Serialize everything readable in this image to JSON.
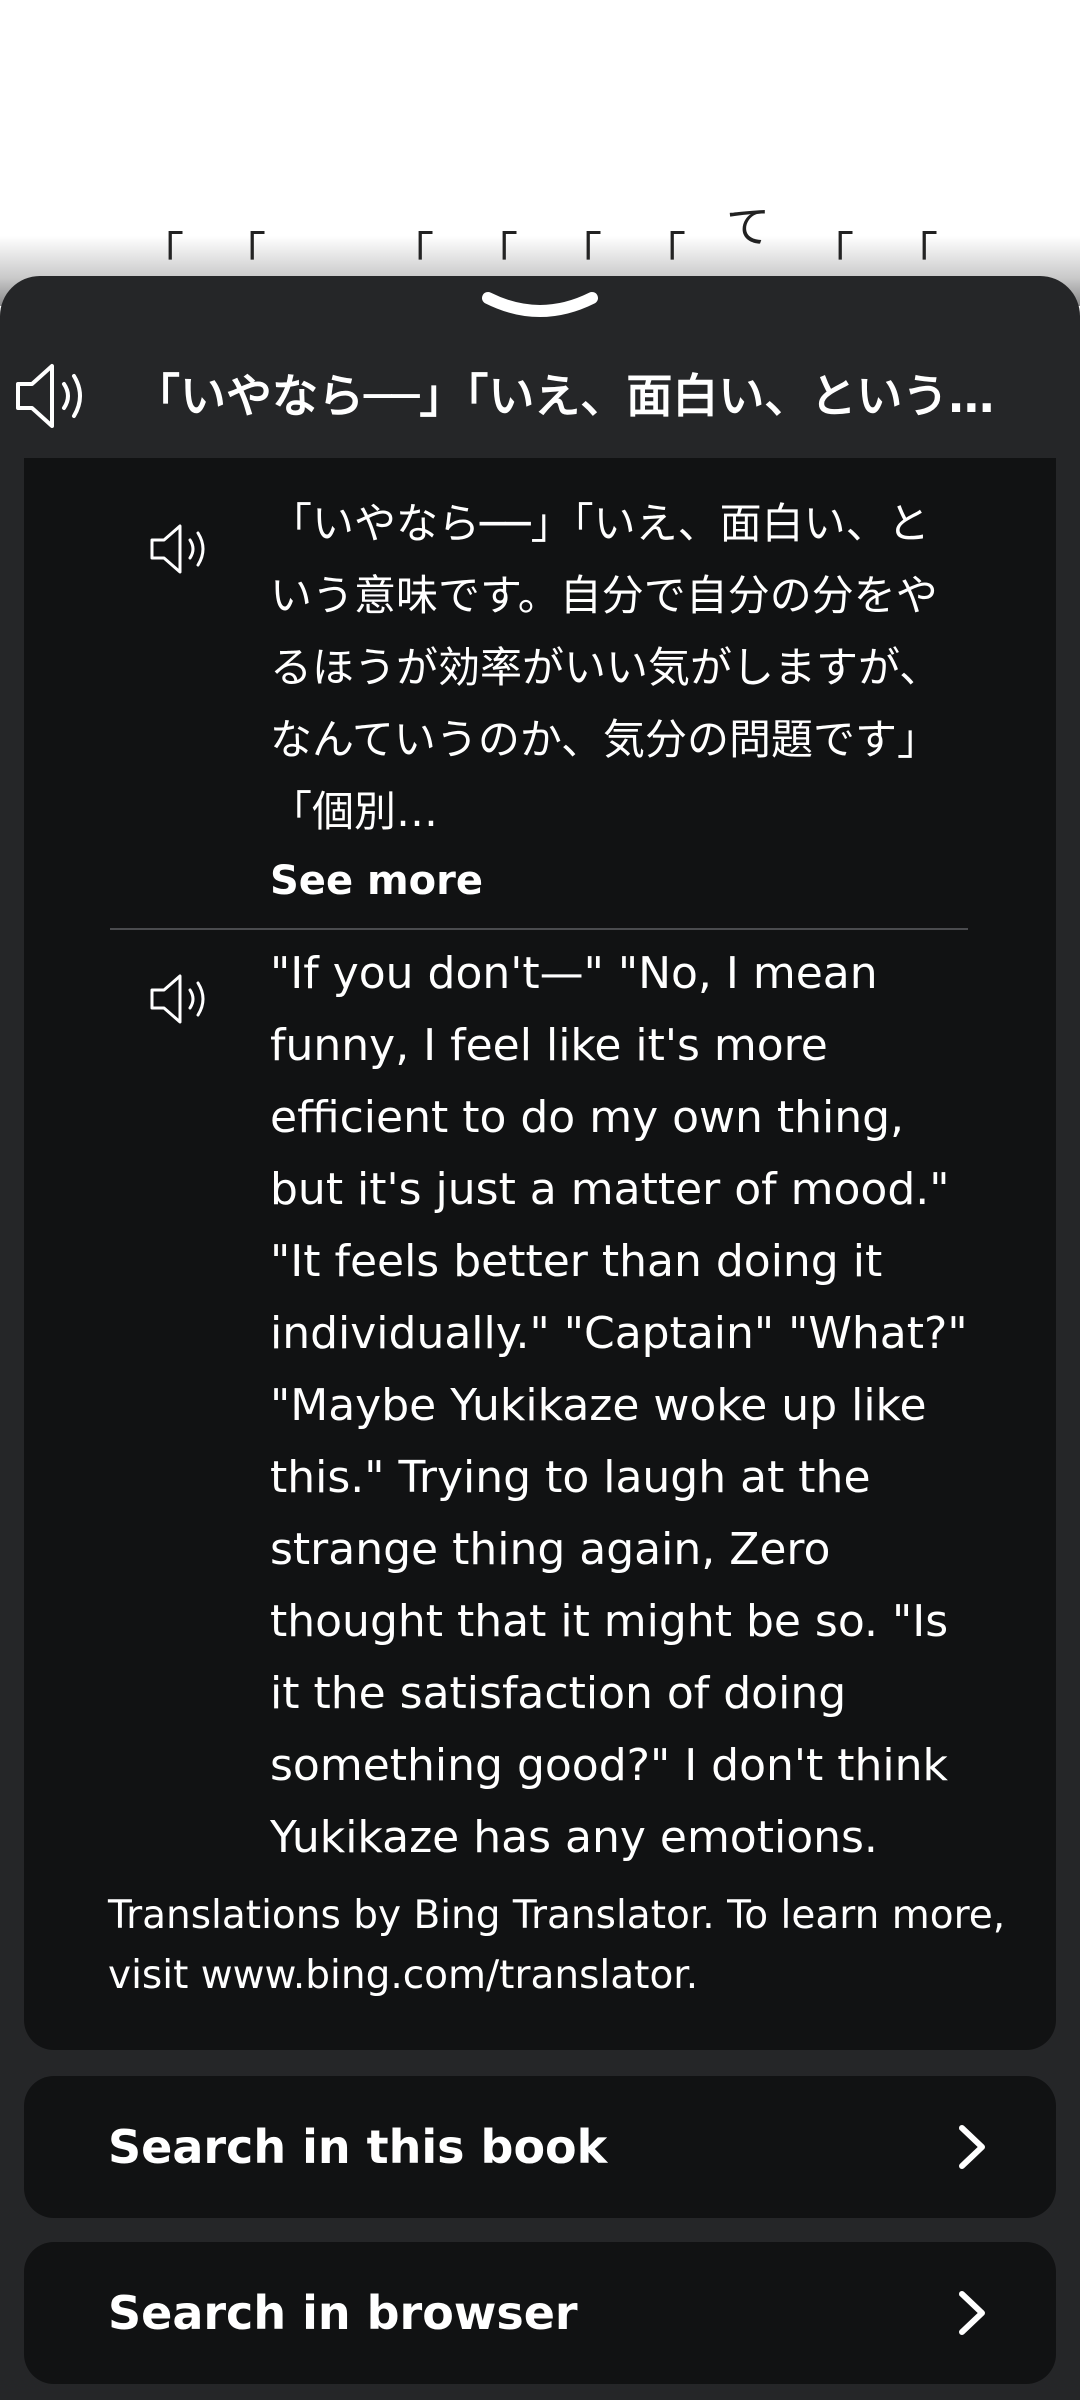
{
  "book": {
    "brackets": [
      "「",
      "「",
      "「",
      "「",
      "「",
      "「",
      "「",
      "「"
    ],
    "te_char": "て"
  },
  "header": {
    "title": "「いやなら──」「いえ、面白い、という意味です。自分で自分の分をやるほうが効率がいい気がしますが、なんていうのか、気分の問題です」「個別…",
    "speaker_icon": "speaker-icon"
  },
  "translation": {
    "original": "「いやなら──」「いえ、面白い、という意味です。自分で自分の分をやるほうが効率がいい気がしますが、なんていうのか、気分の問題です」「個別…",
    "see_more_label": "See more",
    "translated": "\"If you don't—\" \"No, I mean funny, I feel like it's more efficient to do my own thing, but it's just a matter of mood.\" \"It feels better than doing it individually.\" \"Captain\" \"What?\" \"Maybe Yukikaze woke up like this.\" Trying to laugh at the strange thing again, Zero thought that it might be so. \"Is it the satisfaction of doing something good?\" I don't think Yukikaze has any emotions.",
    "credit": "Translations by Bing Translator. To learn more, visit www.bing.com/translator."
  },
  "actions": {
    "search_book": "Search in this book",
    "search_browser": "Search in browser"
  },
  "colors": {
    "sheet_bg": "#252628",
    "card_bg": "#111213",
    "text": "#ffffff"
  }
}
